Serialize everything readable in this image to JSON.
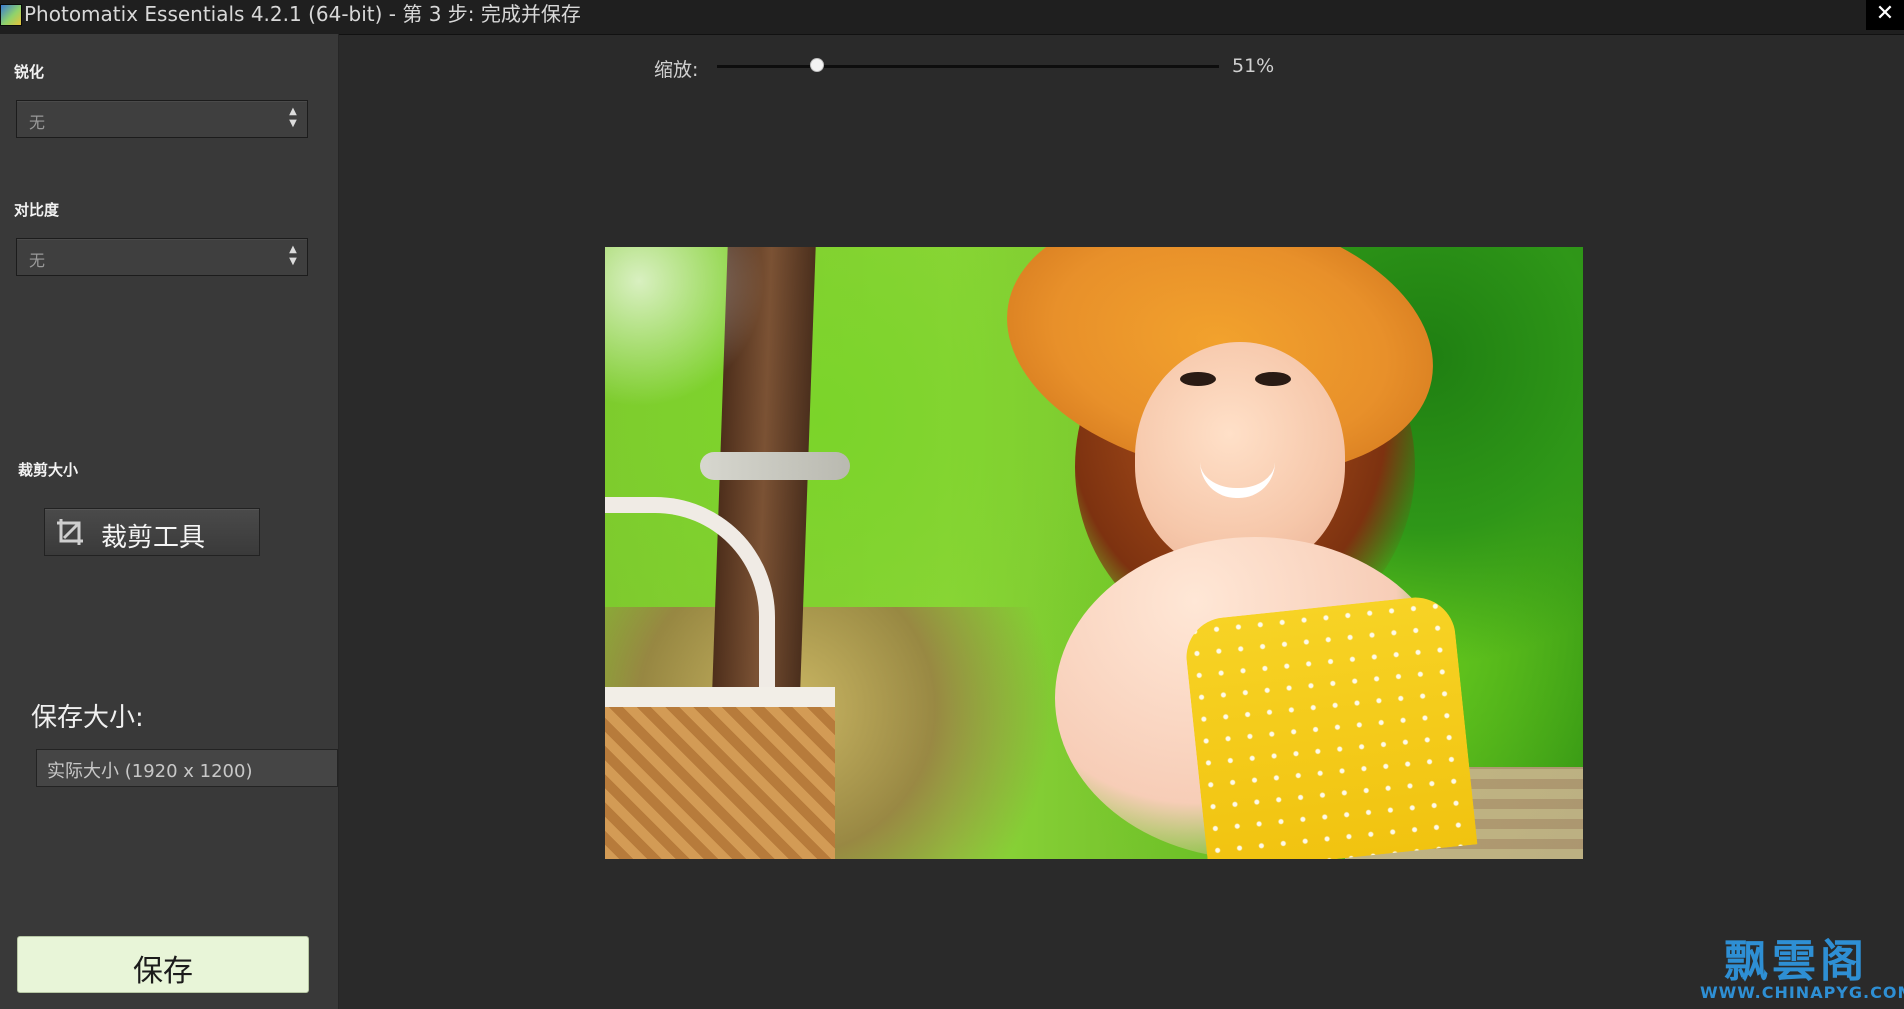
{
  "window": {
    "title": "Photomatix Essentials 4.2.1 (64-bit) - 第 3 步: 完成并保存",
    "close_label": "✕"
  },
  "left_panel": {
    "sharpen": {
      "label": "锐化",
      "value": "无"
    },
    "contrast": {
      "label": "对比度",
      "value": "无"
    },
    "crop": {
      "label": "裁剪大小",
      "button_label": "裁剪工具"
    },
    "save_size": {
      "label": "保存大小:",
      "value": "实际大小 (1920 x 1200)"
    },
    "save_button_label": "保存"
  },
  "preview": {
    "zoom_label": "缩放:",
    "zoom_value": "51%",
    "zoom_fraction": 0.2
  },
  "watermark": {
    "title": "飘雲阁",
    "url": "WWW.CHINAPYG.COM"
  },
  "icons": [
    "app-icon",
    "close-icon",
    "crop-icon",
    "updown-arrows-icon"
  ]
}
